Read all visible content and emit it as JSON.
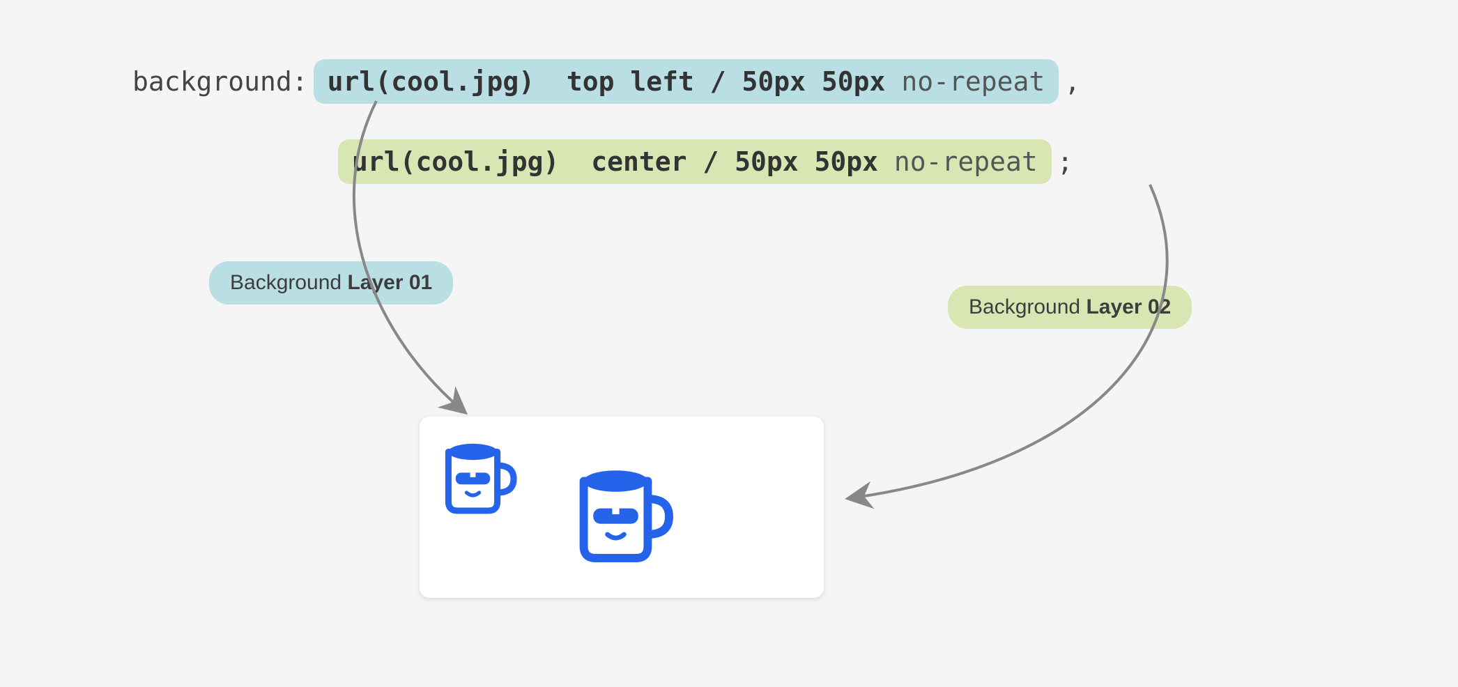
{
  "code": {
    "property": "background:",
    "layer1": {
      "url": "url(cool.jpg)",
      "position": "top left / 50px 50px",
      "repeat": "no-repeat",
      "terminator": ","
    },
    "layer2": {
      "url": "url(cool.jpg)",
      "position": "center / 50px 50px",
      "repeat": "no-repeat",
      "terminator": ";"
    }
  },
  "labels": {
    "layer1_prefix": "Background ",
    "layer1_bold": "Layer 01",
    "layer2_prefix": "Background ",
    "layer2_bold": "Layer 02"
  },
  "colors": {
    "blue": "#b9dee3",
    "green": "#d7e6b3",
    "mug": "#2563eb",
    "arrow": "#888"
  }
}
